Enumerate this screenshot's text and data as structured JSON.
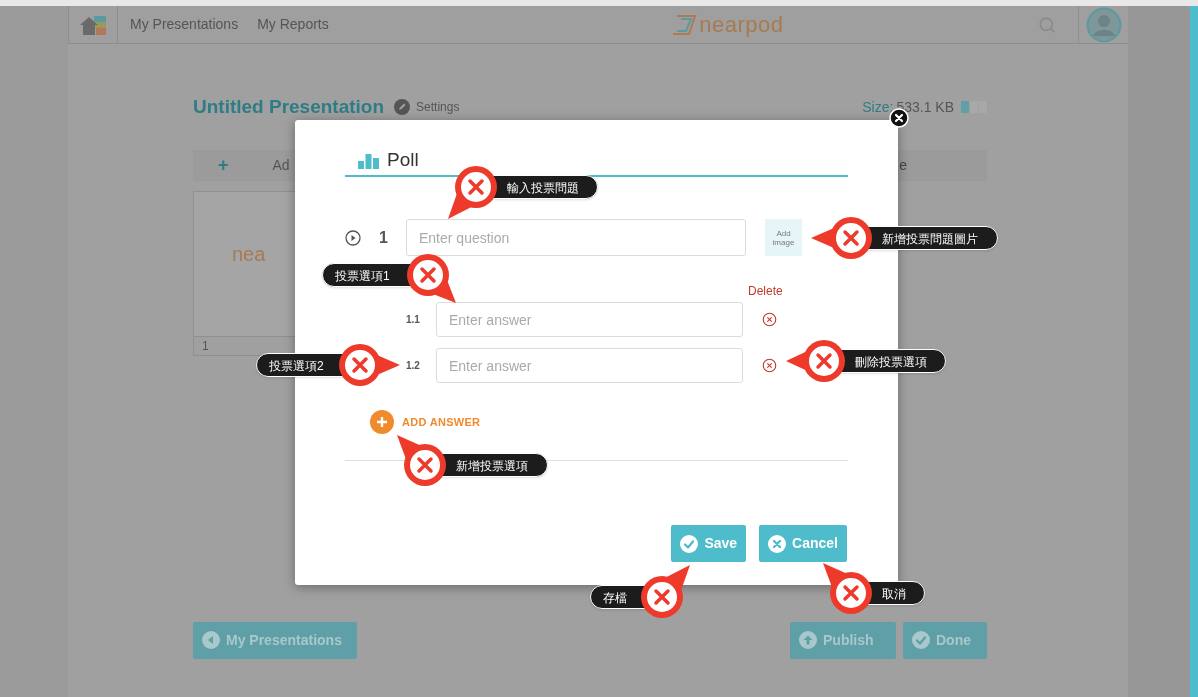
{
  "nav": {
    "links": [
      {
        "label": "My Presentations"
      },
      {
        "label": "My Reports"
      }
    ],
    "logo": "nearpod"
  },
  "presentation": {
    "title": "Untitled Presentation",
    "settings": "Settings",
    "size_label": "Size:",
    "size_value": "533.1 KB",
    "size_meter": {
      "level": 0.33
    },
    "toolbar": {
      "plus": "+",
      "tab_fragment": "Ad",
      "right_fragment": "e"
    },
    "slide": {
      "logo_fragment": "nea",
      "number": "1"
    }
  },
  "dialog": {
    "title": "Poll",
    "question": {
      "number": "1",
      "placeholder": "Enter question"
    },
    "add_image": "Add image",
    "delete_label": "Delete",
    "answers": [
      {
        "number": "1.1",
        "placeholder": "Enter answer"
      },
      {
        "number": "1.2",
        "placeholder": "Enter answer"
      }
    ],
    "add_answer": "ADD ANSWER",
    "buttons": [
      {
        "label": "Save",
        "kind": "save"
      },
      {
        "label": "Cancel",
        "kind": "cancel"
      }
    ]
  },
  "footer_buttons": [
    {
      "label": "My Presentations",
      "kind": "back"
    },
    {
      "label": "Publish",
      "kind": "publish"
    },
    {
      "label": "Done",
      "kind": "done"
    }
  ],
  "callouts": [
    {
      "text": "輸入投票問題"
    },
    {
      "text": "新增投票問題圖片"
    },
    {
      "text": "投票選項1"
    },
    {
      "text": "投票選項2"
    },
    {
      "text": "刪除投票選項"
    },
    {
      "text": "新增投票選項"
    },
    {
      "text": "存檔"
    },
    {
      "text": "取消"
    }
  ]
}
